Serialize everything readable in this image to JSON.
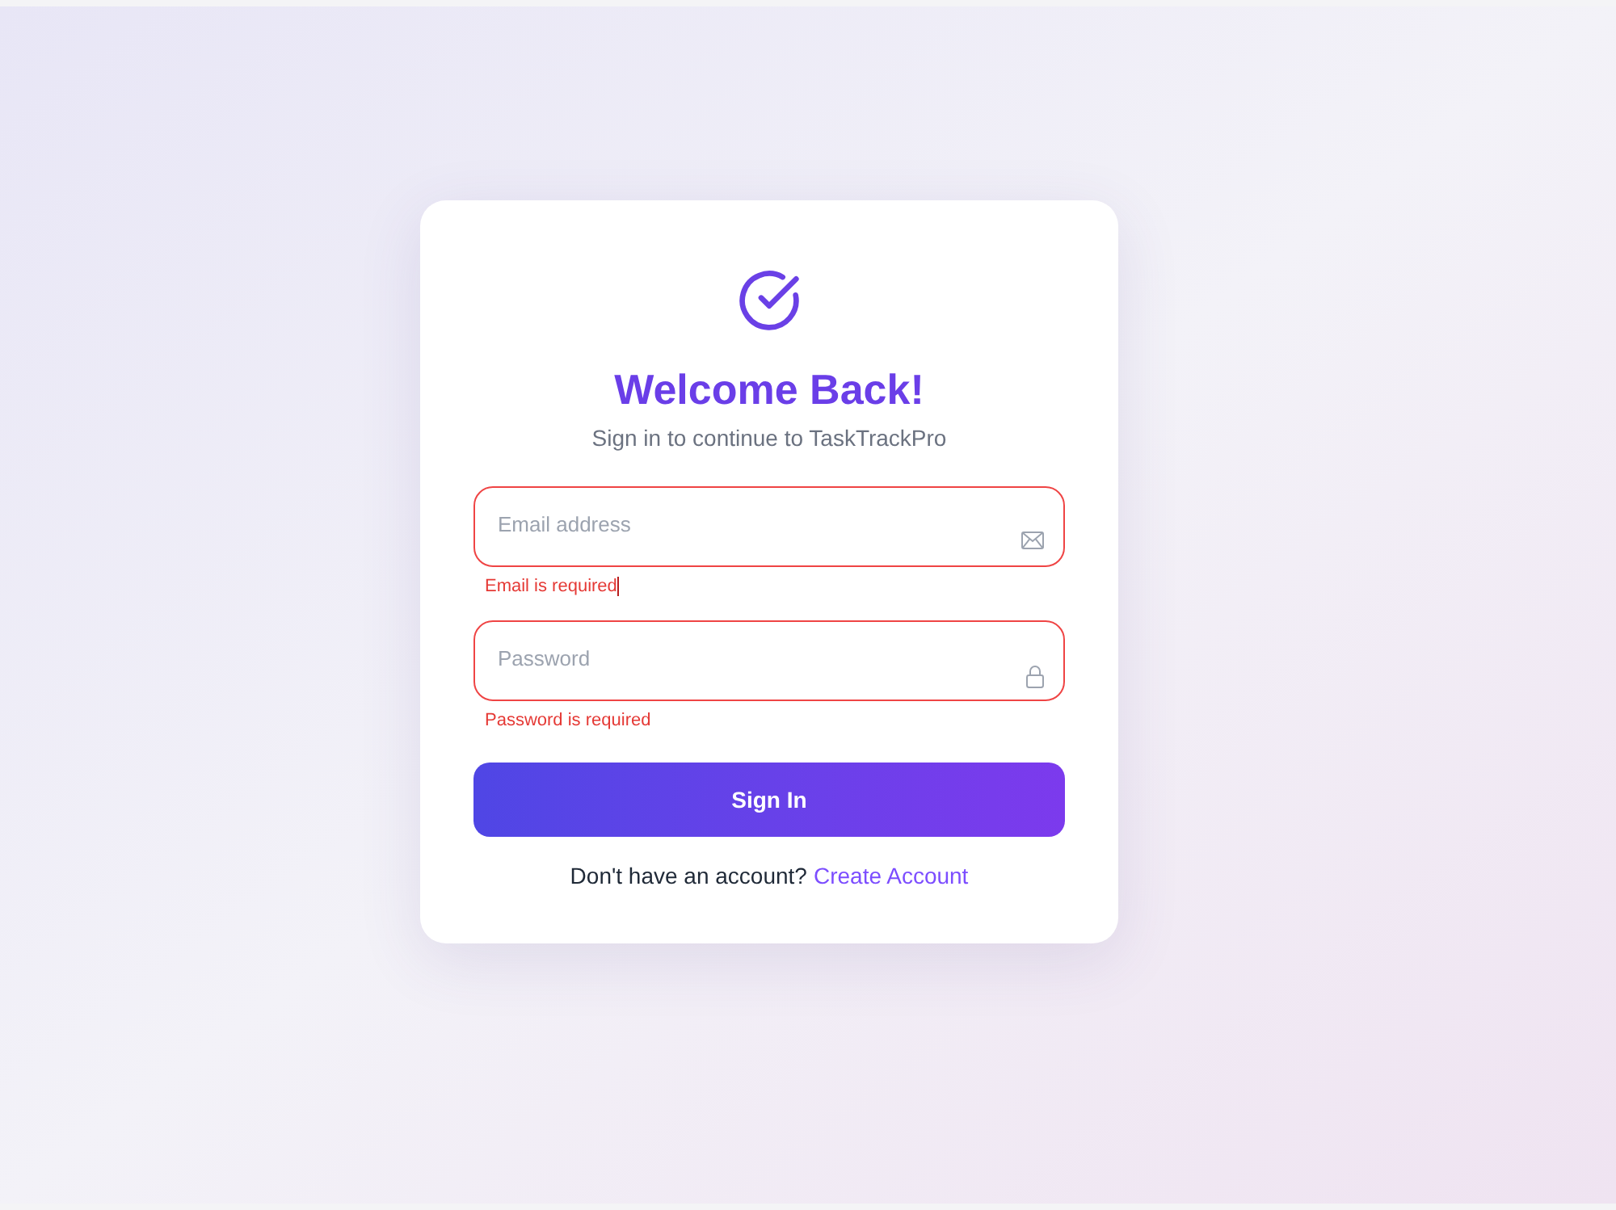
{
  "heading": {
    "title": "Welcome Back!",
    "subtitle": "Sign in to continue to TaskTrackPro"
  },
  "fields": [
    {
      "kind": "email",
      "placeholder": "Email address",
      "invalid": true,
      "error": "Email is required"
    },
    {
      "kind": "password",
      "placeholder": "Password",
      "invalid": true,
      "error": "Password is required"
    }
  ],
  "submit_button": {
    "label": "Sign In"
  },
  "footer": {
    "text": "Don't have an account?",
    "link": "Create Account"
  }
}
